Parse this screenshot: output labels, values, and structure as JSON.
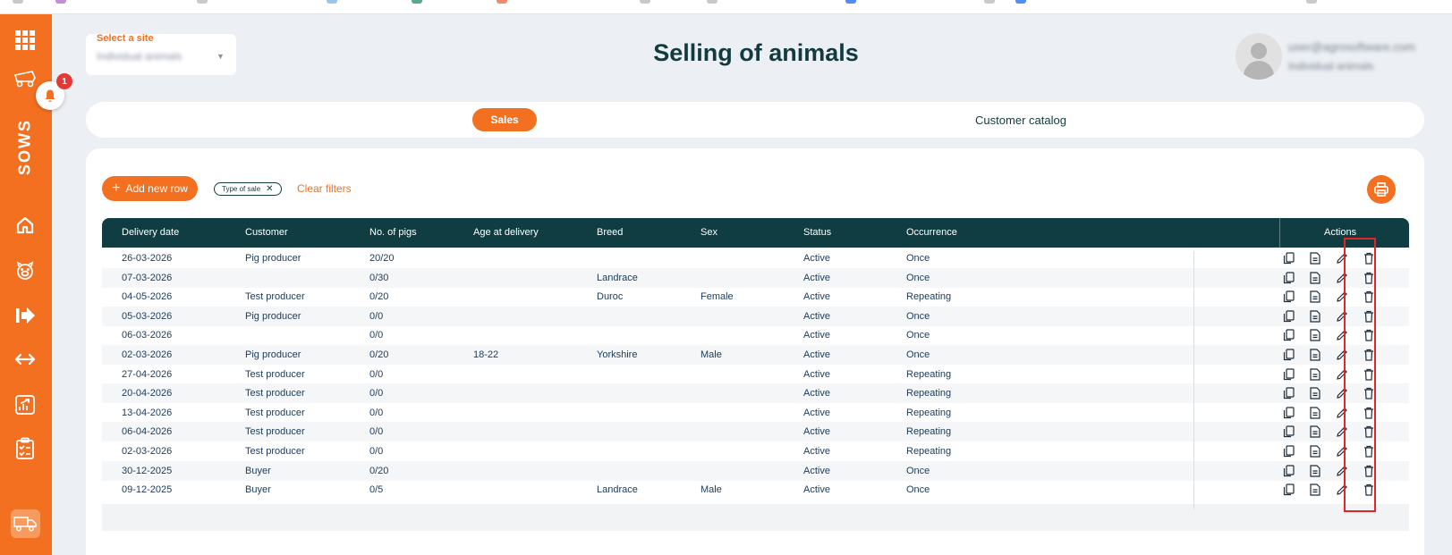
{
  "app": {
    "module_label": "SOWS",
    "notification_count": "1",
    "page_title": "Selling of animals",
    "brand_color": "#f37021",
    "header_color": "#0f3d42"
  },
  "site_selector": {
    "label": "Select a site",
    "value": "Individual animals"
  },
  "user": {
    "email": "user@agrosoftware.com",
    "site": "Individual animals"
  },
  "tabs": [
    {
      "label": "Sales",
      "active": true
    },
    {
      "label": "Customer catalog",
      "active": false
    }
  ],
  "toolbar": {
    "add_label": "Add new row",
    "filter_chip": "Type of sale",
    "clear_filters": "Clear filters"
  },
  "table": {
    "columns": [
      "Delivery date",
      "Customer",
      "No. of pigs",
      "Age at delivery",
      "Breed",
      "Sex",
      "Status",
      "Occurrence",
      "Actions"
    ],
    "rows": [
      [
        "26-03-2026",
        "Pig producer",
        "20/20",
        "",
        "",
        "",
        "Active",
        "Once"
      ],
      [
        "07-03-2026",
        "",
        "0/30",
        "",
        "Landrace",
        "",
        "Active",
        "Once"
      ],
      [
        "04-05-2026",
        "Test producer",
        "0/20",
        "",
        "Duroc",
        "Female",
        "Active",
        "Repeating"
      ],
      [
        "05-03-2026",
        "Pig producer",
        "0/0",
        "",
        "",
        "",
        "Active",
        "Once"
      ],
      [
        "06-03-2026",
        "",
        "0/0",
        "",
        "",
        "",
        "Active",
        "Once"
      ],
      [
        "02-03-2026",
        "Pig producer",
        "0/20",
        "18-22",
        "Yorkshire",
        "Male",
        "Active",
        "Once"
      ],
      [
        "27-04-2026",
        "Test producer",
        "0/0",
        "",
        "",
        "",
        "Active",
        "Repeating"
      ],
      [
        "20-04-2026",
        "Test producer",
        "0/0",
        "",
        "",
        "",
        "Active",
        "Repeating"
      ],
      [
        "13-04-2026",
        "Test producer",
        "0/0",
        "",
        "",
        "",
        "Active",
        "Repeating"
      ],
      [
        "06-04-2026",
        "Test producer",
        "0/0",
        "",
        "",
        "",
        "Active",
        "Repeating"
      ],
      [
        "02-03-2026",
        "Test producer",
        "0/0",
        "",
        "",
        "",
        "Active",
        "Repeating"
      ],
      [
        "30-12-2025",
        "Buyer",
        "0/20",
        "",
        "",
        "",
        "Active",
        "Once"
      ],
      [
        "09-12-2025",
        "Buyer",
        "0/5",
        "",
        "Landrace",
        "Male",
        "Active",
        "Once"
      ]
    ],
    "row_actions": [
      "copy-icon",
      "document-icon",
      "edit-icon",
      "delete-icon"
    ]
  },
  "sidebar_icons": [
    "apps-grid-icon",
    "pig-truck-icon",
    "home-icon",
    "pig-icon",
    "arrow-right-icon",
    "transfer-icon",
    "report-icon",
    "checklist-icon",
    "truck-icon"
  ]
}
